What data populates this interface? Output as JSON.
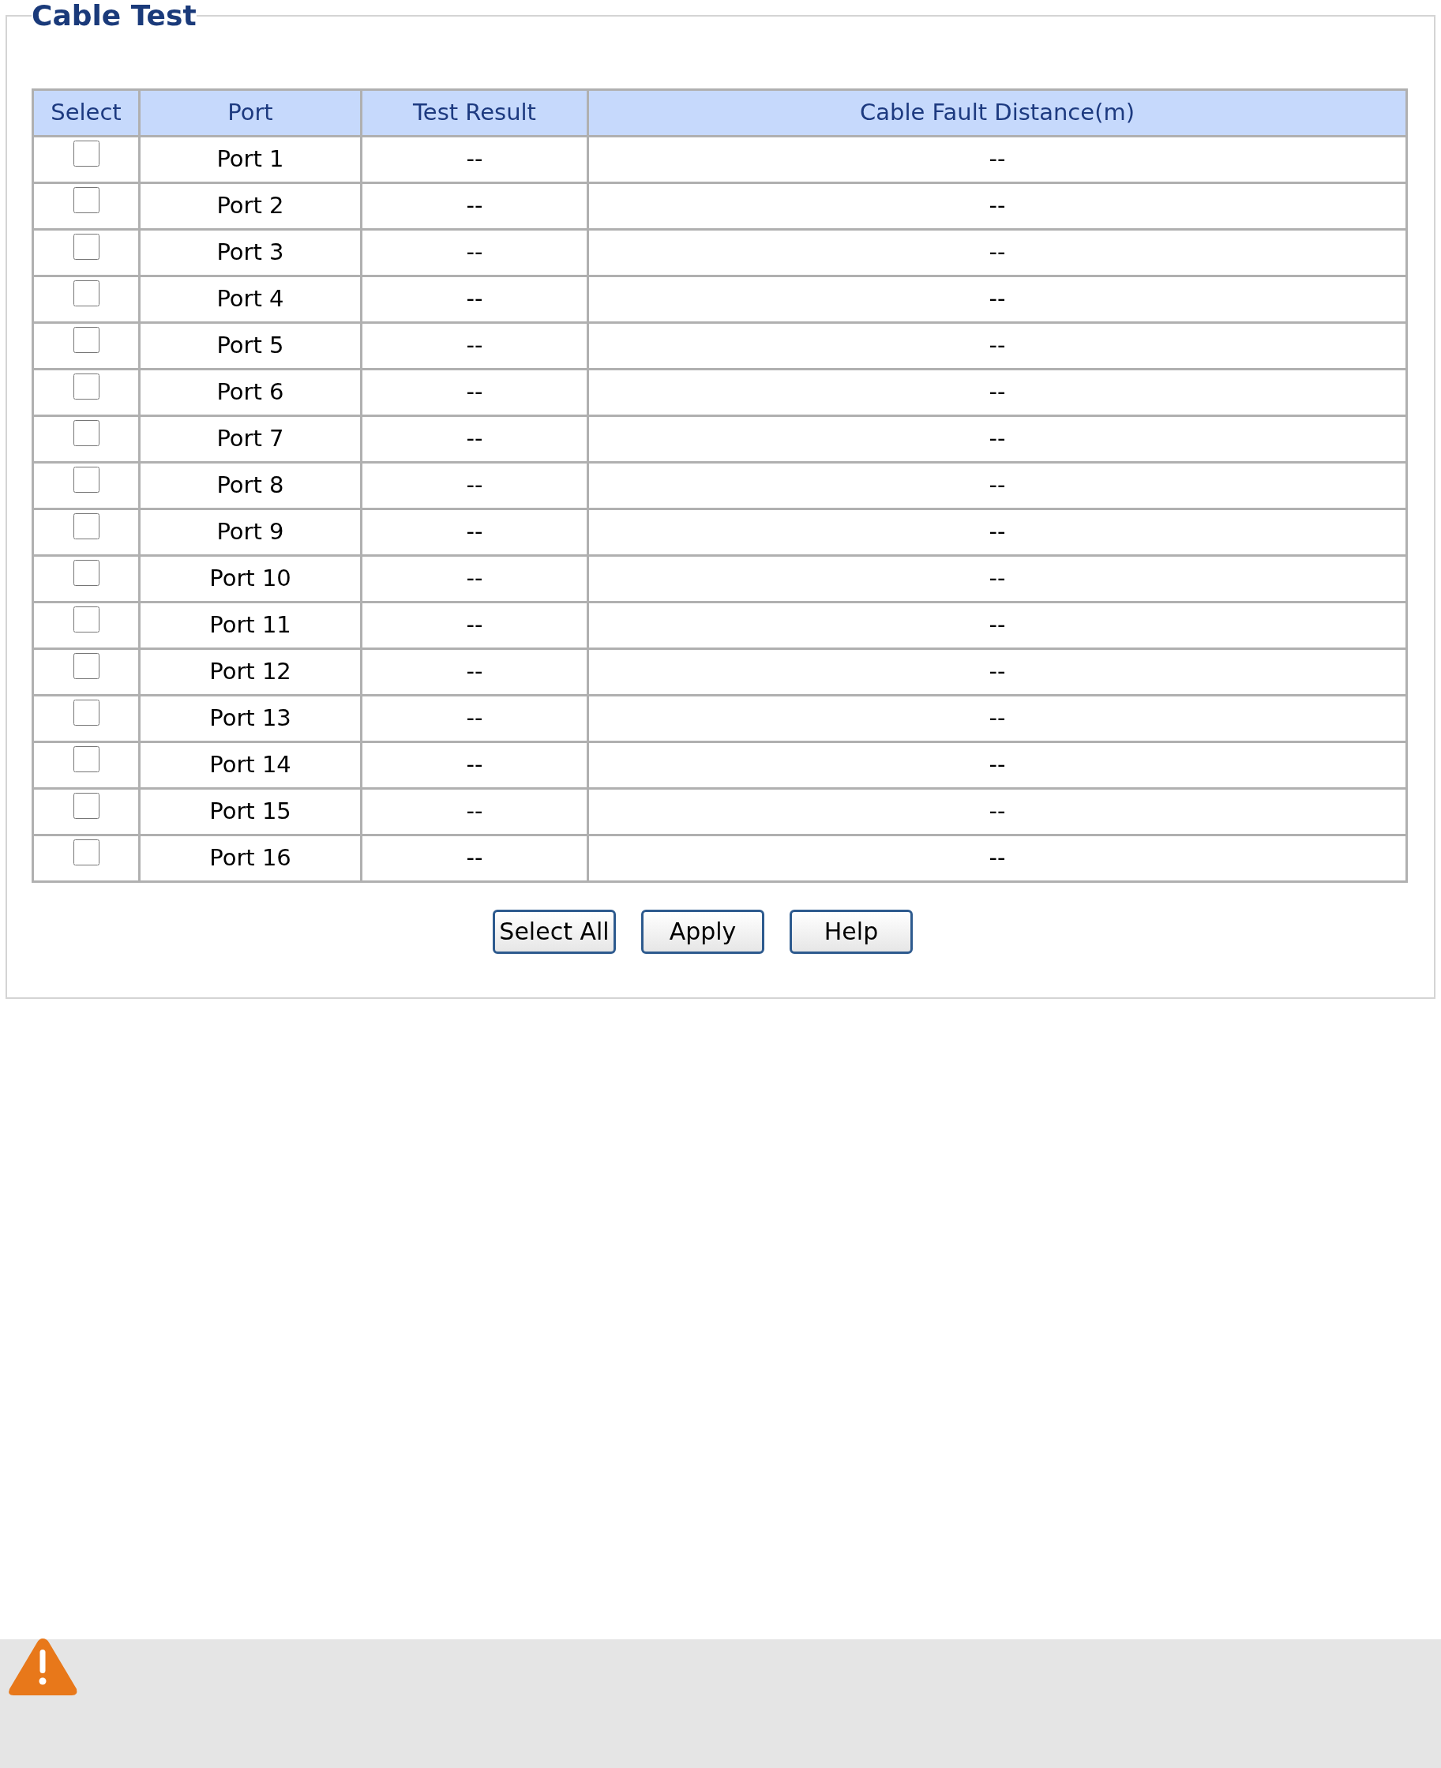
{
  "panel": {
    "title": "Cable Test"
  },
  "table": {
    "columns": [
      "Select",
      "Port",
      "Test Result",
      "Cable Fault Distance(m)"
    ],
    "rows": [
      {
        "checked": false,
        "port": "Port 1",
        "result": "--",
        "distance": "--"
      },
      {
        "checked": false,
        "port": "Port 2",
        "result": "--",
        "distance": "--"
      },
      {
        "checked": false,
        "port": "Port 3",
        "result": "--",
        "distance": "--"
      },
      {
        "checked": false,
        "port": "Port 4",
        "result": "--",
        "distance": "--"
      },
      {
        "checked": false,
        "port": "Port 5",
        "result": "--",
        "distance": "--"
      },
      {
        "checked": false,
        "port": "Port 6",
        "result": "--",
        "distance": "--"
      },
      {
        "checked": false,
        "port": "Port 7",
        "result": "--",
        "distance": "--"
      },
      {
        "checked": false,
        "port": "Port 8",
        "result": "--",
        "distance": "--"
      },
      {
        "checked": false,
        "port": "Port 9",
        "result": "--",
        "distance": "--"
      },
      {
        "checked": false,
        "port": "Port 10",
        "result": "--",
        "distance": "--"
      },
      {
        "checked": false,
        "port": "Port 11",
        "result": "--",
        "distance": "--"
      },
      {
        "checked": false,
        "port": "Port 12",
        "result": "--",
        "distance": "--"
      },
      {
        "checked": false,
        "port": "Port 13",
        "result": "--",
        "distance": "--"
      },
      {
        "checked": false,
        "port": "Port 14",
        "result": "--",
        "distance": "--"
      },
      {
        "checked": false,
        "port": "Port 15",
        "result": "--",
        "distance": "--"
      },
      {
        "checked": false,
        "port": "Port 16",
        "result": "--",
        "distance": "--"
      }
    ]
  },
  "buttons": [
    "Select All",
    "Apply",
    "Help"
  ]
}
